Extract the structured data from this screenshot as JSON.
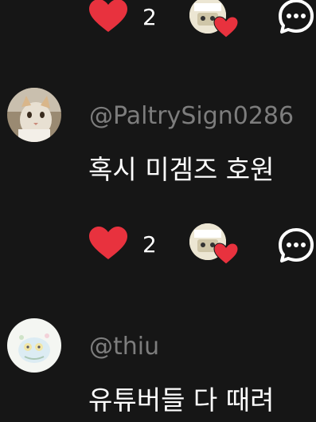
{
  "comments": [
    {
      "likes": "2",
      "icons": {
        "like": "heart-icon",
        "creator": "creator-hearted-icon",
        "reply": "reply-bubble-icon"
      }
    },
    {
      "username": "@PaltrySign0286",
      "text": "혹시 미겜즈 호원",
      "likes": "2",
      "avatar": "cat-avatar",
      "icons": {
        "like": "heart-icon",
        "creator": "creator-hearted-icon",
        "reply": "reply-bubble-icon"
      }
    },
    {
      "username": "@thiu",
      "text": "유튜버들 다 때려",
      "avatar": "cartoon-avatar"
    }
  ],
  "colors": {
    "background": "#161616",
    "heart": "#e8323e",
    "username": "#7d7d7d",
    "text": "#ffffff"
  }
}
